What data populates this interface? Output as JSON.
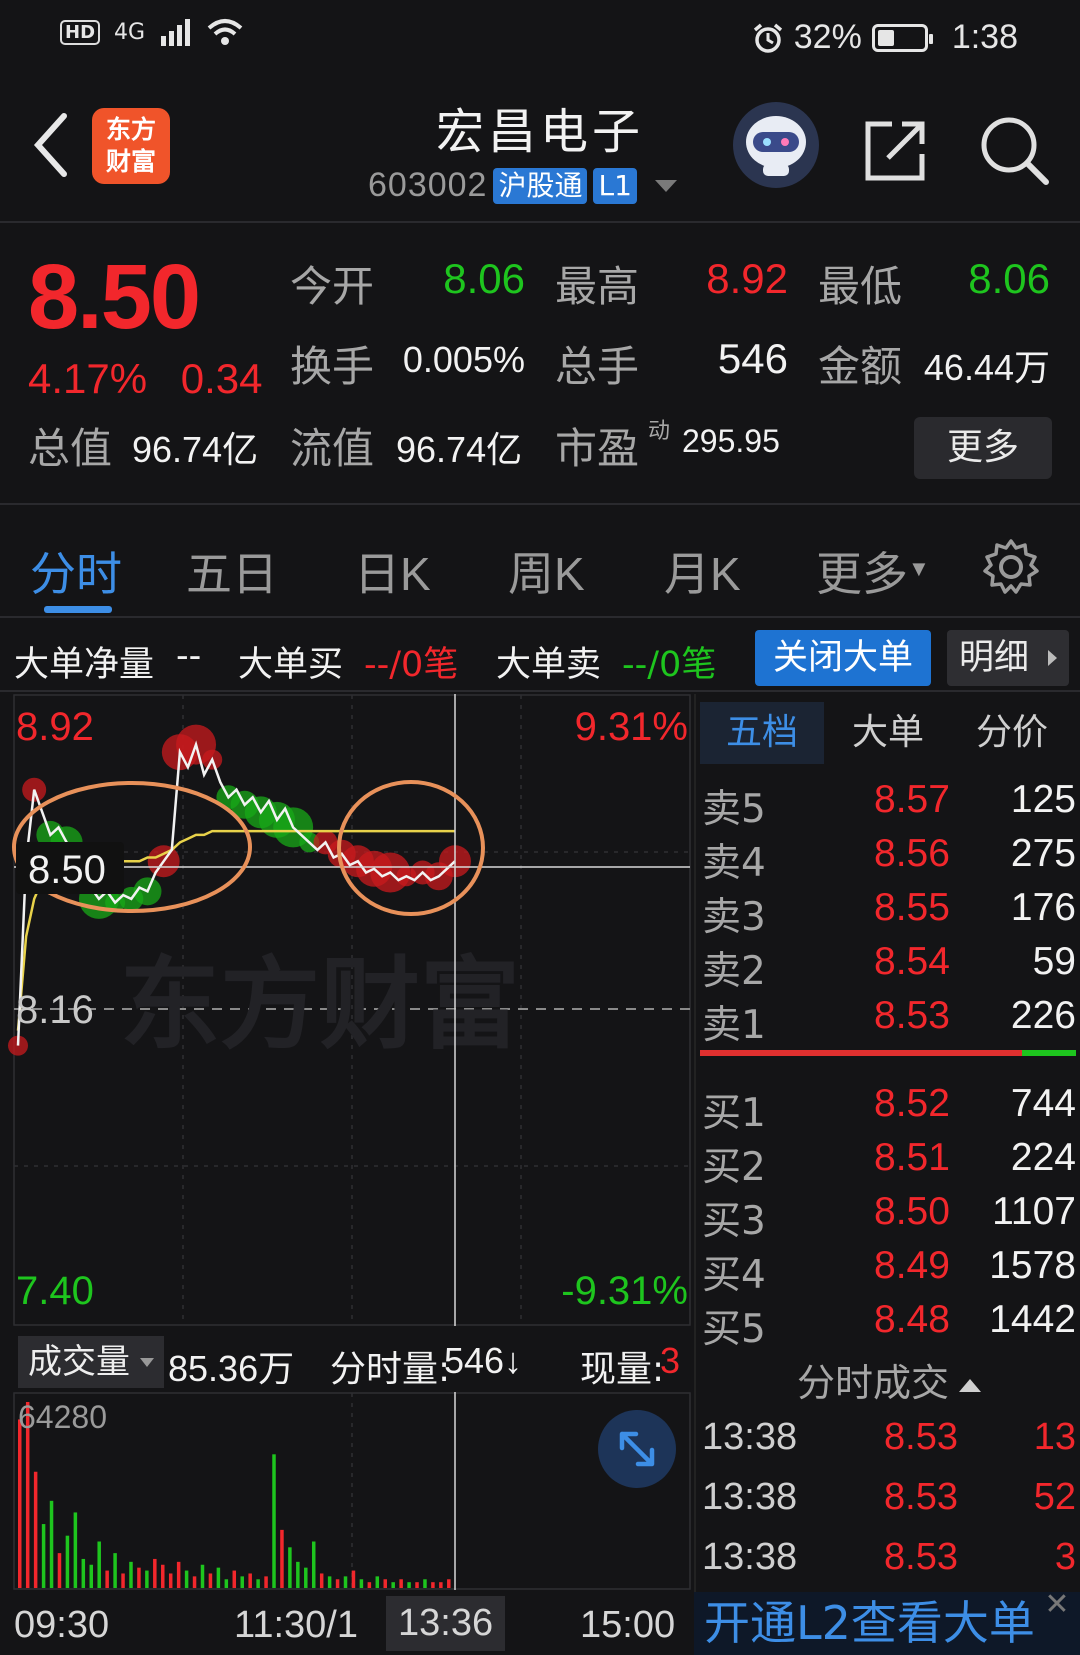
{
  "status_bar": {
    "network": "4G",
    "hd": "HD",
    "battery": "32%",
    "time": "1:38"
  },
  "header": {
    "logo_line1": "东方",
    "logo_line2": "财富",
    "stock_name": "宏昌电子",
    "stock_code": "603002",
    "tag_hk": "沪股通",
    "tag_level": "L1"
  },
  "quote": {
    "last_price": "8.50",
    "change_pct": "4.17%",
    "change_amt": "0.34",
    "open_label": "今开",
    "open": "8.06",
    "high_label": "最高",
    "high": "8.92",
    "low_label": "最低",
    "low": "8.06",
    "turnover_label": "换手",
    "turnover": "0.005%",
    "volume_label": "总手",
    "volume": "546",
    "amount_label": "金额",
    "amount": "46.44万",
    "mktcap_label": "总值",
    "mktcap": "96.74亿",
    "float_label": "流值",
    "float_cap": "96.74亿",
    "pe_label": "市盈",
    "pe_sup": "动",
    "pe": "295.95",
    "more_button": "更多"
  },
  "tabs": [
    "分时",
    "五日",
    "日K",
    "周K",
    "月K",
    "更多"
  ],
  "big_order": {
    "net_label": "大单净量",
    "net_value": "--",
    "buy_label": "大单买",
    "buy_value": "--/0笔",
    "sell_label": "大单卖",
    "sell_value": "--/0笔",
    "close_button": "关闭大单",
    "detail_button": "明细"
  },
  "chart_data": {
    "type": "line",
    "price_high_label": "8.92",
    "price_low_label": "7.40",
    "pct_high_label": "9.31%",
    "pct_low_label": "-9.31%",
    "prev_close_label": "8.16",
    "current_price_label": "8.50",
    "ylim": [
      7.4,
      8.92
    ],
    "prev_close": 8.16,
    "x_labels": [
      "09:30",
      "11:30/1",
      "13:36",
      "15:00"
    ],
    "price_series": [
      8.06,
      8.55,
      8.74,
      8.68,
      8.62,
      8.64,
      8.6,
      8.58,
      8.52,
      8.48,
      8.45,
      8.47,
      8.44,
      8.46,
      8.45,
      8.48,
      8.47,
      8.52,
      8.55,
      8.58,
      8.84,
      8.8,
      8.86,
      8.78,
      8.82,
      8.76,
      8.72,
      8.74,
      8.7,
      8.72,
      8.68,
      8.71,
      8.66,
      8.69,
      8.64,
      8.62,
      8.6,
      8.58,
      8.6,
      8.56,
      8.57,
      8.54,
      8.55,
      8.52,
      8.53,
      8.51,
      8.52,
      8.5,
      8.51,
      8.5,
      8.52,
      8.5,
      8.51,
      8.53,
      8.55
    ],
    "avg_series": [
      8.1,
      8.35,
      8.45,
      8.5,
      8.52,
      8.54,
      8.55,
      8.55,
      8.55,
      8.55,
      8.55,
      8.55,
      8.55,
      8.55,
      8.55,
      8.55,
      8.56,
      8.56,
      8.57,
      8.58,
      8.6,
      8.61,
      8.62,
      8.62,
      8.63,
      8.63,
      8.63,
      8.63,
      8.63,
      8.63,
      8.63,
      8.63,
      8.63,
      8.63,
      8.63,
      8.63,
      8.63,
      8.63,
      8.63,
      8.63,
      8.63,
      8.63,
      8.63,
      8.63,
      8.63,
      8.63,
      8.63,
      8.63,
      8.63,
      8.63,
      8.63,
      8.63,
      8.63,
      8.63,
      8.63
    ],
    "volume_max_label": "64280",
    "volume_series": [
      58,
      64,
      40,
      22,
      30,
      12,
      18,
      26,
      10,
      8,
      16,
      6,
      12,
      5,
      9,
      7,
      6,
      10,
      8,
      5,
      9,
      6,
      4,
      8,
      5,
      7,
      3,
      6,
      4,
      5,
      3,
      4,
      46,
      20,
      14,
      9,
      7,
      16,
      5,
      4,
      3,
      4,
      6,
      3,
      2,
      4,
      3,
      2,
      3,
      2,
      2,
      3,
      2,
      2,
      3
    ]
  },
  "volume_header": {
    "select_label": "成交量",
    "total": "85.36万",
    "minute_label": "分时量:",
    "minute_value": "546↓",
    "current_label": "现量:",
    "current_value": "3"
  },
  "order_book": {
    "tabs": [
      "五档",
      "大单",
      "分价"
    ],
    "asks": [
      {
        "label": "卖5",
        "price": "8.57",
        "volume": "125"
      },
      {
        "label": "卖4",
        "price": "8.56",
        "volume": "275"
      },
      {
        "label": "卖3",
        "price": "8.55",
        "volume": "176"
      },
      {
        "label": "卖2",
        "price": "8.54",
        "volume": "59"
      },
      {
        "label": "卖1",
        "price": "8.53",
        "volume": "226"
      }
    ],
    "bids": [
      {
        "label": "买1",
        "price": "8.52",
        "volume": "744"
      },
      {
        "label": "买2",
        "price": "8.51",
        "volume": "224"
      },
      {
        "label": "买3",
        "price": "8.50",
        "volume": "1107"
      },
      {
        "label": "买4",
        "price": "8.49",
        "volume": "1578"
      },
      {
        "label": "买5",
        "price": "8.48",
        "volume": "1442"
      }
    ]
  },
  "ticks": {
    "title": "分时成交",
    "rows": [
      {
        "time": "13:38",
        "price": "8.53",
        "volume": "13"
      },
      {
        "time": "13:38",
        "price": "8.53",
        "volume": "52"
      },
      {
        "time": "13:38",
        "price": "8.53",
        "volume": "3"
      }
    ]
  },
  "l2_banner": "开通L2查看大单",
  "watermark": "东方财富",
  "colors": {
    "up": "#f2272c",
    "down": "#1ec51e",
    "accent": "#3d8ee6",
    "annotation_circle": "#e8915a"
  }
}
